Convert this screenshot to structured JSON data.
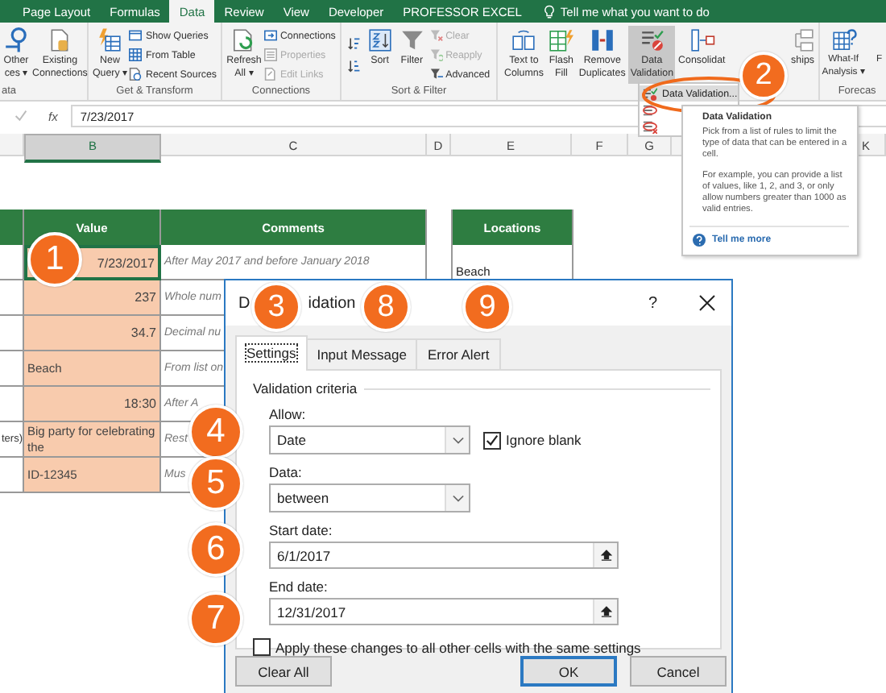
{
  "ribbon_tabs": [
    {
      "label": "Page Layout",
      "selected": false
    },
    {
      "label": "Formulas",
      "selected": false
    },
    {
      "label": "Data",
      "selected": true
    },
    {
      "label": "Review",
      "selected": false
    },
    {
      "label": "View",
      "selected": false
    },
    {
      "label": "Developer",
      "selected": false
    },
    {
      "label": "PROFESSOR EXCEL",
      "selected": false
    }
  ],
  "tell_me": "Tell me what you want to do",
  "ribbon_groups": [
    {
      "label": "ata",
      "items": [
        {
          "kind": "large",
          "lines": [
            "Other",
            "ces ▾"
          ],
          "pressed": false
        },
        {
          "kind": "large",
          "lines": [
            "Existing",
            "Connections"
          ],
          "pressed": false
        }
      ]
    },
    {
      "label": "Get & Transform",
      "items": [
        {
          "kind": "large",
          "lines": [
            "New",
            "Query ▾"
          ],
          "pressed": false
        },
        {
          "kind": "stack",
          "rows": [
            {
              "label": "Show Queries",
              "disabled": false
            },
            {
              "label": "From Table",
              "disabled": false
            },
            {
              "label": "Recent Sources",
              "disabled": false
            }
          ]
        }
      ]
    },
    {
      "label": "Connections",
      "items": [
        {
          "kind": "large",
          "lines": [
            "Refresh",
            "All ▾"
          ],
          "pressed": false
        },
        {
          "kind": "stack",
          "rows": [
            {
              "label": "Connections",
              "disabled": false
            },
            {
              "label": "Properties",
              "disabled": true
            },
            {
              "label": "Edit Links",
              "disabled": true
            }
          ]
        }
      ]
    },
    {
      "label": "Sort & Filter",
      "items": [
        {
          "kind": "sortpair"
        },
        {
          "kind": "large",
          "lines": [
            "Sort"
          ],
          "pressed": false
        },
        {
          "kind": "large",
          "lines": [
            "Filter"
          ],
          "pressed": false
        },
        {
          "kind": "stack",
          "rows": [
            {
              "label": "Clear",
              "disabled": true
            },
            {
              "label": "Reapply",
              "disabled": true
            },
            {
              "label": "Advanced",
              "disabled": false
            }
          ]
        }
      ]
    },
    {
      "items": [
        {
          "kind": "large",
          "lines": [
            "Text to",
            "Columns"
          ],
          "pressed": false
        },
        {
          "kind": "large",
          "lines": [
            "Flash",
            "Fill"
          ],
          "pressed": false
        },
        {
          "kind": "large",
          "lines": [
            "Remove",
            "Duplicates"
          ],
          "pressed": false
        },
        {
          "kind": "large",
          "lines": [
            "Data",
            "Validation"
          ],
          "pressed": true
        },
        {
          "kind": "large",
          "lines": [
            "Consolidat"
          ],
          "pressed": false
        },
        {
          "kind": "large",
          "lines": [
            "ships"
          ],
          "pressed": false
        }
      ]
    },
    {
      "label": "Forecas",
      "items": [
        {
          "kind": "large",
          "lines": [
            "What-If",
            "Analysis ▾"
          ],
          "pressed": false
        },
        {
          "kind": "large",
          "lines": [
            "F"
          ],
          "pressed": false
        }
      ]
    }
  ],
  "formula_bar": {
    "function_label": "fx",
    "value": "7/23/2017"
  },
  "columns": [
    {
      "letter": "B",
      "selected": true
    },
    {
      "letter": "C",
      "selected": false
    },
    {
      "letter": "D",
      "selected": false
    },
    {
      "letter": "E",
      "selected": false
    },
    {
      "letter": "F",
      "selected": false
    },
    {
      "letter": "G",
      "selected": false
    },
    {
      "letter": "K",
      "selected": false
    }
  ],
  "table": {
    "headers": [
      "Value",
      "Comments"
    ],
    "rows": [
      {
        "value": "7/23/2017",
        "kind": "number",
        "comment": "After May 2017 and before January 2018",
        "selected": true
      },
      {
        "value": "237",
        "kind": "number",
        "comment": "Whole num",
        "selected": false
      },
      {
        "value": "34.7",
        "kind": "number",
        "comment": "Decimal nu",
        "selected": false
      },
      {
        "value": "Beach",
        "kind": "text",
        "comment": "From list on",
        "selected": false
      },
      {
        "value": "18:30",
        "kind": "number",
        "comment": "After A",
        "selected": false
      },
      {
        "column_a": "ters)",
        "value": "Big party for celebrating the",
        "kind": "text",
        "comment": "Rest",
        "selected": false
      },
      {
        "value": "ID-12345",
        "kind": "text",
        "comment": "Mus",
        "selected": false
      }
    ]
  },
  "locations": {
    "header": "Locations",
    "items": [
      "Beach"
    ]
  },
  "dropdown": {
    "items": [
      {
        "label": "Data Validation...",
        "selected": true
      },
      {
        "selected": false
      },
      {
        "selected": false
      }
    ]
  },
  "tooltip": {
    "title": "Data Validation",
    "paragraphs": [
      "Pick from a list of rules to limit the type of data that can be entered in a cell.",
      "For example, you can provide a list of values, like 1, 2, and 3, or only allow numbers greater than 1000 as valid entries."
    ],
    "link": "Tell me more"
  },
  "dialog": {
    "title_parts": [
      "D",
      "idation"
    ],
    "help": "?",
    "tabs": [
      {
        "label": "Settings",
        "selected": true
      },
      {
        "label": "Input Message",
        "selected": false
      },
      {
        "label": "Error Alert",
        "selected": false
      }
    ],
    "section": "Validation criteria",
    "allow": {
      "label": "Allow:",
      "value": "Date"
    },
    "ignore_blank": {
      "label": "Ignore blank",
      "checked": true
    },
    "data": {
      "label": "Data:",
      "value": "between"
    },
    "start_date": {
      "label": "Start date:",
      "value": "6/1/2017"
    },
    "end_date": {
      "label": "End date:",
      "value": "12/31/2017"
    },
    "apply_all": {
      "label": "Apply these changes to all other cells with the same settings",
      "checked": false
    },
    "buttons": [
      {
        "label": "Clear All",
        "kind": "plain"
      },
      {
        "label": "OK",
        "kind": "default"
      },
      {
        "label": "Cancel",
        "kind": "plain"
      }
    ]
  },
  "callouts": [
    "1",
    "2",
    "3",
    "8",
    "9",
    "4",
    "5",
    "6",
    "7"
  ]
}
